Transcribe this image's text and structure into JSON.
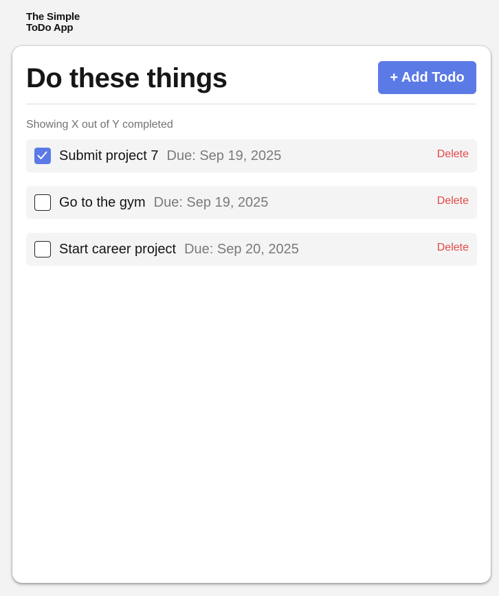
{
  "app": {
    "title_line1": "The Simple",
    "title_line2": "ToDo App"
  },
  "header": {
    "title": "Do these things",
    "add_button_label": "+ Add Todo"
  },
  "status_text": "Showing X out of Y completed",
  "todos": [
    {
      "title": "Submit project 7",
      "due": "Due: Sep 19, 2025",
      "completed": true,
      "delete_label": "Delete"
    },
    {
      "title": "Go to the gym",
      "due": "Due: Sep 19, 2025",
      "completed": false,
      "delete_label": "Delete"
    },
    {
      "title": "Start career project",
      "due": "Due: Sep 20, 2025",
      "completed": false,
      "delete_label": "Delete"
    }
  ],
  "colors": {
    "accent": "#5b7ae6",
    "delete": "#e54848",
    "background": "#f3f3f3",
    "item_background": "#f4f4f4"
  },
  "icons": {
    "checked": "checkmark-icon"
  }
}
